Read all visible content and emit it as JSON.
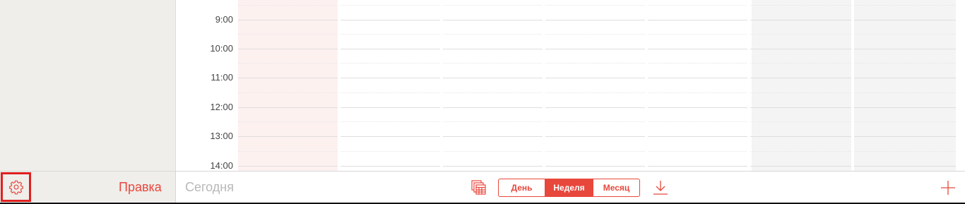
{
  "time_slots": [
    "9:00",
    "10:00",
    "11:00",
    "12:00",
    "13:00",
    "14:00"
  ],
  "toolbar": {
    "edit_label": "Правка",
    "today_label": "Сегодня",
    "view_switcher": {
      "options": [
        "День",
        "Неделя",
        "Месяц"
      ],
      "selected": "Неделя"
    }
  },
  "icons": {
    "settings": "gear-icon",
    "calendars": "calendars-icon",
    "inbox": "download-icon",
    "add": "plus-icon"
  },
  "colors": {
    "accent": "#e8473c",
    "today_column": "#fdf1f0",
    "weekend_column": "#f4f4f4",
    "sidebar": "#efeeeb",
    "highlight_box": "#e02020"
  }
}
